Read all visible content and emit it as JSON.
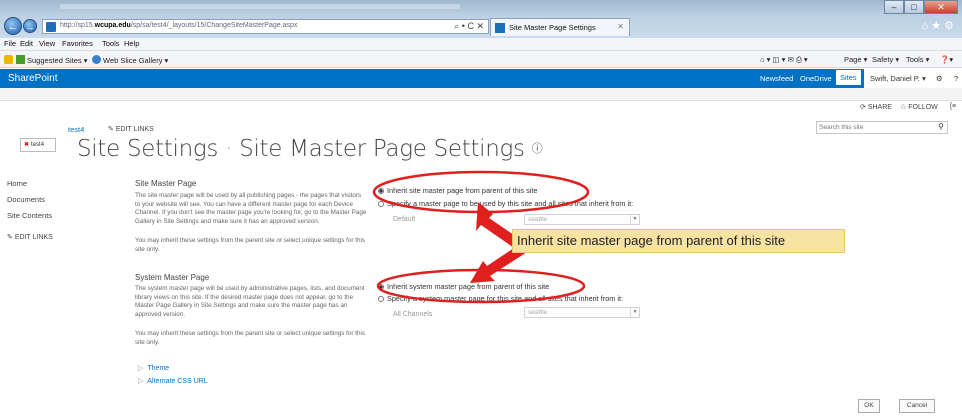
{
  "browser": {
    "url_prefix": "http://sp15.",
    "url_host": "wcupa.edu",
    "url_path": "/sp/sa/test4/_layouts/15/ChangeSiteMasterPage.aspx",
    "url_controls": "⌕ • C ✕",
    "tab_title": "Site Master Page Settings",
    "menu": [
      "File",
      "Edit",
      "View",
      "Favorites",
      "Tools",
      "Help"
    ],
    "favorites": [
      {
        "label": "Suggested Sites ▾"
      },
      {
        "label": "Web Slice Gallery ▾"
      }
    ],
    "command_bar": [
      "Page ▾",
      "Safety ▾",
      "Tools ▾"
    ]
  },
  "suite": {
    "brand": "SharePoint",
    "links": [
      "Newsfeed",
      "OneDrive",
      "Sites"
    ],
    "user": "Swift, Daniel P. ▾",
    "help": "?"
  },
  "actions": {
    "share": "SHARE",
    "follow": "FOLLOW"
  },
  "site": {
    "logo_text": "test4",
    "breadcrumb": "test4",
    "edit_links": "EDIT LINKS",
    "title_left": "Site Settings",
    "title_sep": "·",
    "title_right": "Site Master Page Settings",
    "info_icon": "ⓘ",
    "search_placeholder": "Search this site"
  },
  "quick_launch": [
    "Home",
    "Documents",
    "Site Contents"
  ],
  "ql_edit_links": "EDIT LINKS",
  "site_master": {
    "title": "Site Master Page",
    "desc": "The site master page will be used by all publishing pages - the pages that visitors to your website will see. You can have a different master page for each Device Channel. If you don't see the master page you're looking for, go to the Master Page Gallery in Site Settings and make sure it has an approved version.",
    "desc2": "You may inherit these settings from the parent site or select unique settings for this site only.",
    "opt_inherit": "Inherit site master page from parent of this site",
    "opt_specify": "Specify a master page to be used by this site and all sites that inherit from it:",
    "channel_label": "Default",
    "dropdown_value": "seattle"
  },
  "system_master": {
    "title": "System Master Page",
    "desc": "The system master page will be used by administrative pages, lists, and document library views on this site. If the desired master page does not appear, go to the Master Page Gallery in Site Settings and make sure the master page has an approved version.",
    "desc2": "You may inherit these settings from the parent site or select unique settings for this site only.",
    "opt_inherit": "Inherit system master page from parent of this site",
    "opt_specify": "Specify a system master page for this site and all sites that inherit from it:",
    "channel_label": "All Channels",
    "dropdown_value": "seattle"
  },
  "expanders": [
    "Theme",
    "Alternate CSS URL"
  ],
  "buttons": {
    "ok": "OK",
    "cancel": "Cancel"
  },
  "annotation": {
    "text": "Inherit site master page from parent of this site"
  },
  "colors": {
    "accent": "#0072c6",
    "annotation_red": "#e01f1f",
    "callout_bg": "#f6e2a3"
  }
}
